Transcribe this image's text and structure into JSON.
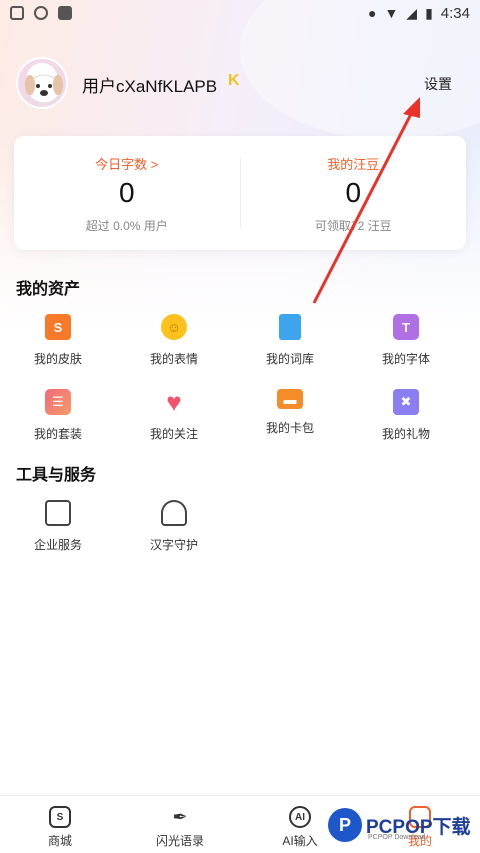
{
  "status_bar": {
    "time": "4:34"
  },
  "profile": {
    "username": "用户cXaNfKLAPB",
    "vip_icon": "vip-k-badge",
    "settings_label": "设置"
  },
  "stats": [
    {
      "label": "今日字数 >",
      "value": "0",
      "sub": "超过 0.0% 用户"
    },
    {
      "label": "我的汪豆",
      "value": "0",
      "sub": "可领取72 汪豆"
    }
  ],
  "assets": {
    "title": "我的资产",
    "items": [
      {
        "label": "我的皮肤",
        "icon": "skin-icon"
      },
      {
        "label": "我的表情",
        "icon": "emoji-icon"
      },
      {
        "label": "我的词库",
        "icon": "lexicon-icon"
      },
      {
        "label": "我的字体",
        "icon": "font-icon"
      },
      {
        "label": "我的套装",
        "icon": "suite-icon"
      },
      {
        "label": "我的关注",
        "icon": "heart-icon"
      },
      {
        "label": "我的卡包",
        "icon": "card-icon"
      },
      {
        "label": "我的礼物",
        "icon": "gift-icon"
      }
    ]
  },
  "tools": {
    "title": "工具与服务",
    "items": [
      {
        "label": "企业服务",
        "icon": "document-icon"
      },
      {
        "label": "汉字守护",
        "icon": "hands-icon"
      }
    ]
  },
  "bottom_nav": [
    {
      "label": "商城",
      "icon": "store-icon"
    },
    {
      "label": "闪光语录",
      "icon": "feather-icon"
    },
    {
      "label": "AI输入",
      "icon": "ai-icon",
      "icon_text": "AI"
    },
    {
      "label": "我的",
      "icon": "profile-icon"
    }
  ],
  "colors": {
    "accent": "#f0602a",
    "arrow": "#e8322a",
    "vip": "#f3c21c"
  },
  "watermark": {
    "text": "PCPOP下载",
    "sub": "PCPOP Download",
    "letter": "P"
  }
}
